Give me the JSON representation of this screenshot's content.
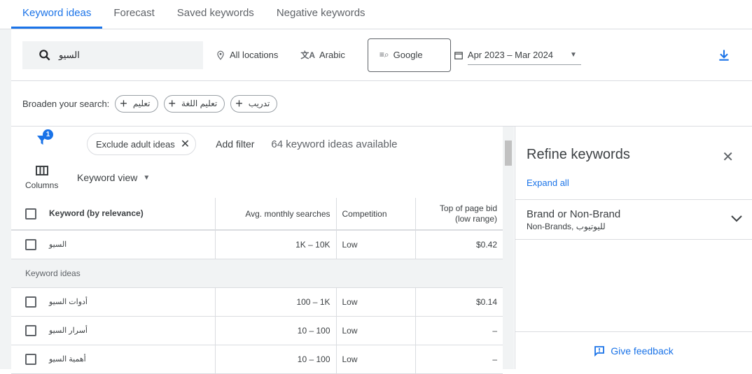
{
  "tabs": [
    "Keyword ideas",
    "Forecast",
    "Saved keywords",
    "Negative keywords"
  ],
  "search": {
    "value": "السيو"
  },
  "toolbar": {
    "location": "All locations",
    "language": "Arabic",
    "network": "Google",
    "date_range": "Apr 2023 – Mar 2024"
  },
  "broaden": {
    "label": "Broaden your search:",
    "chips": [
      "تعليم",
      "تعليم اللغة",
      "تدريب"
    ]
  },
  "filters": {
    "badge": "1",
    "chip": "Exclude adult ideas",
    "add_filter": "Add filter",
    "count": "64 keyword ideas available"
  },
  "columns": {
    "label": "Columns",
    "view": "Keyword view"
  },
  "table": {
    "headers": [
      "Keyword (by relevance)",
      "Avg. monthly searches",
      "Competition",
      "Top of page bid",
      "(low range)"
    ],
    "searched": {
      "keyword": "السيو",
      "searches": "1K – 10K",
      "competition": "Low",
      "bid": "$0.42"
    },
    "group_label": "Keyword ideas",
    "rows": [
      {
        "keyword": "أدوات السيو",
        "searches": "100 – 1K",
        "competition": "Low",
        "bid": "$0.14"
      },
      {
        "keyword": "أسرار السيو",
        "searches": "10 – 100",
        "competition": "Low",
        "bid": "–"
      },
      {
        "keyword": "أهمية السيو",
        "searches": "10 – 100",
        "competition": "Low",
        "bid": "–"
      }
    ]
  },
  "refine": {
    "title": "Refine keywords",
    "expand_all": "Expand all",
    "brand_title": "Brand or Non-Brand",
    "brand_sub": "Non-Brands, لليوتيوب",
    "feedback": "Give feedback"
  },
  "colors": {
    "accent": "#1a73e8"
  }
}
